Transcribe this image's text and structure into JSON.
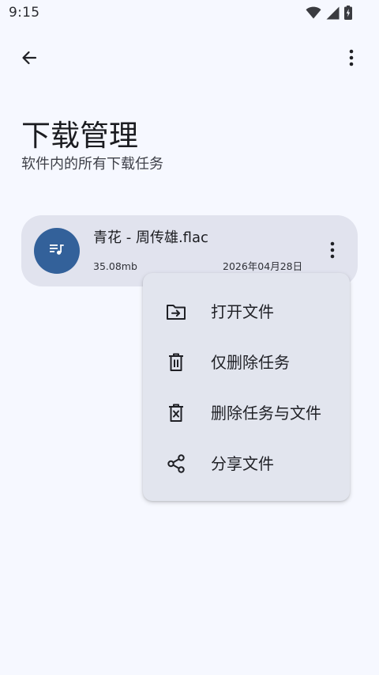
{
  "status_bar": {
    "time": "9:15",
    "icons": [
      "wifi-icon",
      "cellular-signal-icon",
      "battery-charging-icon"
    ]
  },
  "top_bar": {
    "back_icon": "arrow-back-icon",
    "more_icon": "more-vert-icon"
  },
  "header": {
    "title": "下载管理",
    "subtitle": "软件内的所有下载任务"
  },
  "downloads": [
    {
      "file_name": "青花 - 周传雄.flac",
      "size": "35.08mb",
      "date": "2026年04月28日",
      "icon": "music-queue-icon",
      "more_icon": "more-vert-icon"
    }
  ],
  "context_menu": {
    "items": [
      {
        "label": "打开文件",
        "icon": "folder-open-icon"
      },
      {
        "label": "仅删除任务",
        "icon": "delete-icon"
      },
      {
        "label": "删除任务与文件",
        "icon": "delete-forever-icon"
      },
      {
        "label": "分享文件",
        "icon": "share-icon"
      }
    ]
  },
  "colors": {
    "background": "#f6f8ff",
    "card": "#e1e3ee",
    "menu": "#e2e5ee",
    "avatar": "#33619a",
    "text_primary": "#1b1c20",
    "text_secondary": "#3e4048"
  }
}
